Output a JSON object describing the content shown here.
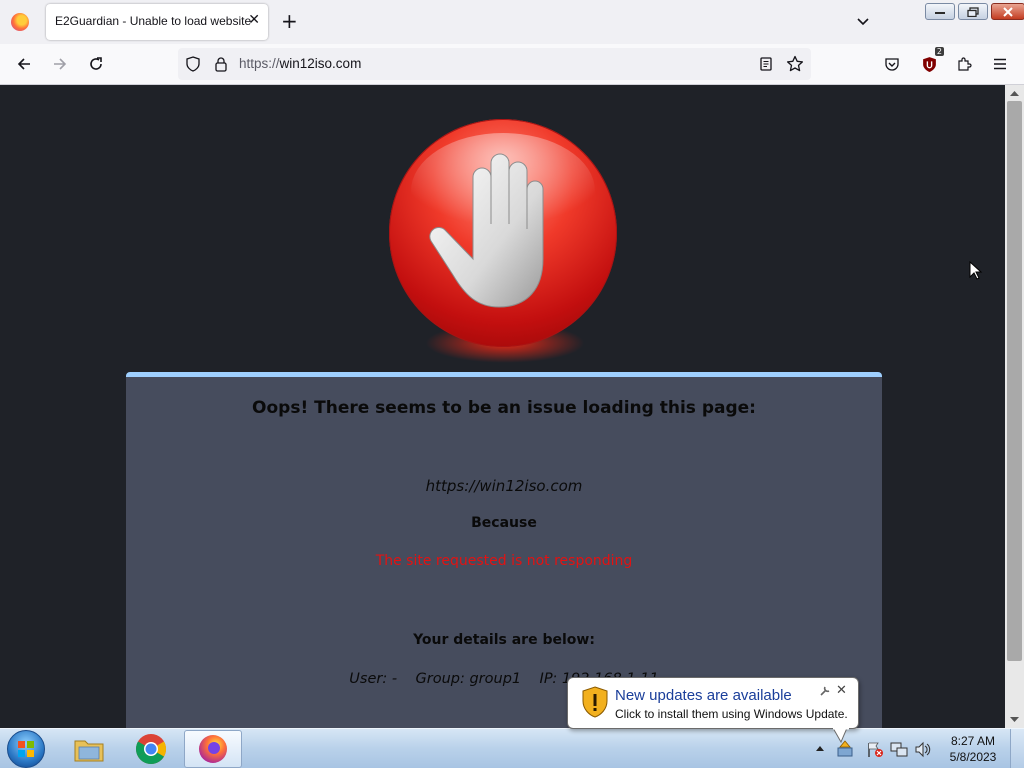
{
  "browser": {
    "tab_title": "E2Guardian - Unable to load website",
    "tab_close": "✕",
    "new_tab": "+",
    "url_scheme": "https://",
    "url_host": "win12iso.com",
    "extension_badge": "2"
  },
  "page": {
    "heading": "Oops! There seems to be an issue loading this page:",
    "blocked_url": "https://win12iso.com",
    "because_label": "Because",
    "reason": "The site requested is not responding",
    "details_heading": "Your details are below:",
    "user_line": "User: -    Group: group1    IP: 192.168.1.11"
  },
  "notification": {
    "title": "New updates are available",
    "text": "Click to install them using Windows Update.",
    "close": "✕"
  },
  "taskbar": {
    "apps": [
      "file-explorer",
      "chrome",
      "firefox"
    ],
    "active_app": "firefox"
  },
  "clock": {
    "time": "8:27 AM",
    "date": "5/8/2023"
  },
  "colors": {
    "page_bg": "#1f2228",
    "panel_bg": "#464c5d",
    "panel_accent": "#9fd0ff",
    "reason_red": "#e31212",
    "notification_title": "#1a3e9a"
  }
}
